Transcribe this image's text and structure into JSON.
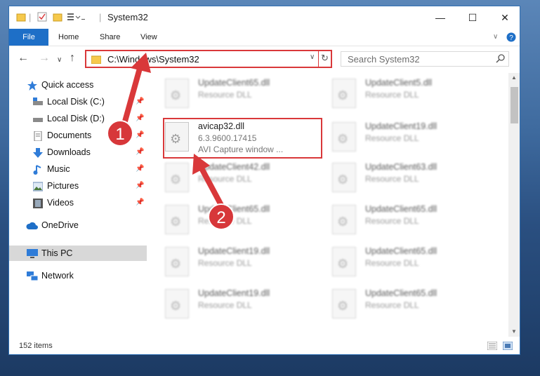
{
  "window": {
    "title": "System32",
    "minimize_label": "—",
    "maximize_label": "☐",
    "close_label": "✕"
  },
  "ribbon": {
    "tabs": [
      "File",
      "Home",
      "Share",
      "View"
    ]
  },
  "address": {
    "path": "C:\\Windows\\System32",
    "search_placeholder": "Search System32"
  },
  "navpane": {
    "items": [
      {
        "label": "Quick access",
        "icon": "star-icon",
        "pinned": false
      },
      {
        "label": "Local Disk (C:)",
        "icon": "drive-icon",
        "pinned": true
      },
      {
        "label": "Local Disk (D:)",
        "icon": "drive-icon",
        "pinned": true
      },
      {
        "label": "Documents",
        "icon": "documents-icon",
        "pinned": true
      },
      {
        "label": "Downloads",
        "icon": "downloads-icon",
        "pinned": true
      },
      {
        "label": "Music",
        "icon": "music-icon",
        "pinned": true
      },
      {
        "label": "Pictures",
        "icon": "pictures-icon",
        "pinned": true
      },
      {
        "label": "Videos",
        "icon": "videos-icon",
        "pinned": true
      },
      {
        "label": "OneDrive",
        "icon": "onedrive-icon",
        "pinned": false
      },
      {
        "label": "This PC",
        "icon": "pc-icon",
        "pinned": false,
        "selected": true
      },
      {
        "label": "Network",
        "icon": "network-icon",
        "pinned": false
      }
    ]
  },
  "files": {
    "left": [
      {
        "name": "UpdateClient65.dll",
        "type": "Resource DLL"
      },
      {
        "name": "avicap32.dll",
        "type": "6.3.9600.17415",
        "desc": "AVI Capture window ...",
        "highlighted": true
      },
      {
        "name": "UpdateClient42.dll",
        "type": "Resource DLL"
      },
      {
        "name": "UpdateClient65.dll",
        "type": "Resource DLL"
      },
      {
        "name": "UpdateClient19.dll",
        "type": "Resource DLL"
      },
      {
        "name": "UpdateClient19.dll",
        "type": "Resource DLL"
      }
    ],
    "right": [
      {
        "name": "UpdateClient5.dll",
        "type": "Resource DLL"
      },
      {
        "name": "UpdateClient19.dll",
        "type": "Resource DLL"
      },
      {
        "name": "UpdateClient63.dll",
        "type": "Resource DLL"
      },
      {
        "name": "UpdateClient65.dll",
        "type": "Resource DLL"
      },
      {
        "name": "UpdateClient65.dll",
        "type": "Resource DLL"
      },
      {
        "name": "UpdateClient65.dll",
        "type": "Resource DLL"
      }
    ]
  },
  "status": {
    "item_count": "152 items"
  },
  "annotations": {
    "badge1": "1",
    "badge2": "2"
  },
  "colors": {
    "accent": "#1e6fc7",
    "highlight": "#d9383a"
  }
}
